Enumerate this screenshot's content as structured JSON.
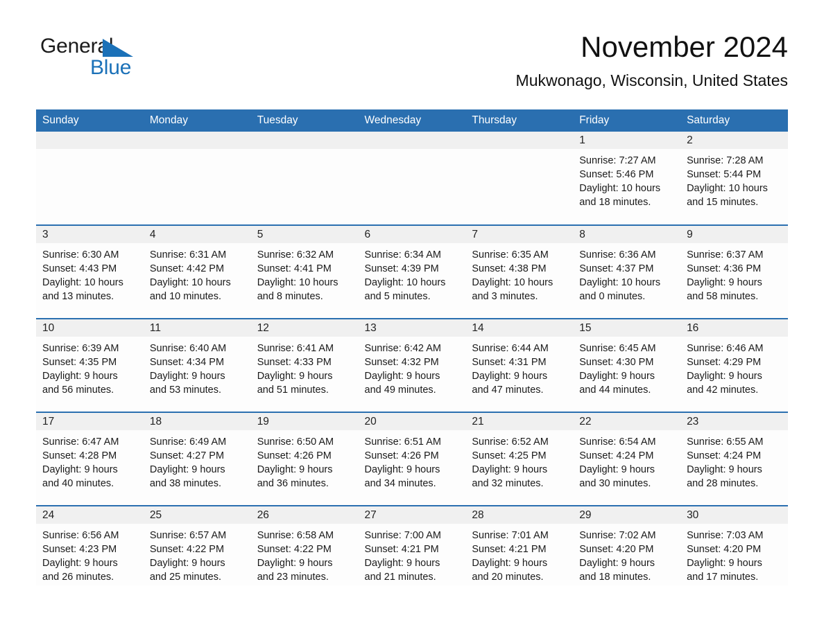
{
  "brand": {
    "name_part1": "General",
    "name_part2": "Blue",
    "logo_icon": "triangle-logo-icon"
  },
  "header": {
    "title": "November 2024",
    "subtitle": "Mukwonago, Wisconsin, United States"
  },
  "colors": {
    "header_blue": "#2a6fb0",
    "brand_blue": "#1b71b8",
    "day_band_gray": "#f0f0f0",
    "cell_background": "#fdfdfd",
    "text": "#1a1a1a"
  },
  "weekdays": [
    "Sunday",
    "Monday",
    "Tuesday",
    "Wednesday",
    "Thursday",
    "Friday",
    "Saturday"
  ],
  "weeks": [
    [
      {
        "day": "",
        "empty": true,
        "sunrise": "",
        "sunset": "",
        "daylight1": "",
        "daylight2": ""
      },
      {
        "day": "",
        "empty": true,
        "sunrise": "",
        "sunset": "",
        "daylight1": "",
        "daylight2": ""
      },
      {
        "day": "",
        "empty": true,
        "sunrise": "",
        "sunset": "",
        "daylight1": "",
        "daylight2": ""
      },
      {
        "day": "",
        "empty": true,
        "sunrise": "",
        "sunset": "",
        "daylight1": "",
        "daylight2": ""
      },
      {
        "day": "",
        "empty": true,
        "sunrise": "",
        "sunset": "",
        "daylight1": "",
        "daylight2": ""
      },
      {
        "day": "1",
        "empty": false,
        "sunrise": "Sunrise: 7:27 AM",
        "sunset": "Sunset: 5:46 PM",
        "daylight1": "Daylight: 10 hours",
        "daylight2": "and 18 minutes."
      },
      {
        "day": "2",
        "empty": false,
        "sunrise": "Sunrise: 7:28 AM",
        "sunset": "Sunset: 5:44 PM",
        "daylight1": "Daylight: 10 hours",
        "daylight2": "and 15 minutes."
      }
    ],
    [
      {
        "day": "3",
        "empty": false,
        "sunrise": "Sunrise: 6:30 AM",
        "sunset": "Sunset: 4:43 PM",
        "daylight1": "Daylight: 10 hours",
        "daylight2": "and 13 minutes."
      },
      {
        "day": "4",
        "empty": false,
        "sunrise": "Sunrise: 6:31 AM",
        "sunset": "Sunset: 4:42 PM",
        "daylight1": "Daylight: 10 hours",
        "daylight2": "and 10 minutes."
      },
      {
        "day": "5",
        "empty": false,
        "sunrise": "Sunrise: 6:32 AM",
        "sunset": "Sunset: 4:41 PM",
        "daylight1": "Daylight: 10 hours",
        "daylight2": "and 8 minutes."
      },
      {
        "day": "6",
        "empty": false,
        "sunrise": "Sunrise: 6:34 AM",
        "sunset": "Sunset: 4:39 PM",
        "daylight1": "Daylight: 10 hours",
        "daylight2": "and 5 minutes."
      },
      {
        "day": "7",
        "empty": false,
        "sunrise": "Sunrise: 6:35 AM",
        "sunset": "Sunset: 4:38 PM",
        "daylight1": "Daylight: 10 hours",
        "daylight2": "and 3 minutes."
      },
      {
        "day": "8",
        "empty": false,
        "sunrise": "Sunrise: 6:36 AM",
        "sunset": "Sunset: 4:37 PM",
        "daylight1": "Daylight: 10 hours",
        "daylight2": "and 0 minutes."
      },
      {
        "day": "9",
        "empty": false,
        "sunrise": "Sunrise: 6:37 AM",
        "sunset": "Sunset: 4:36 PM",
        "daylight1": "Daylight: 9 hours",
        "daylight2": "and 58 minutes."
      }
    ],
    [
      {
        "day": "10",
        "empty": false,
        "sunrise": "Sunrise: 6:39 AM",
        "sunset": "Sunset: 4:35 PM",
        "daylight1": "Daylight: 9 hours",
        "daylight2": "and 56 minutes."
      },
      {
        "day": "11",
        "empty": false,
        "sunrise": "Sunrise: 6:40 AM",
        "sunset": "Sunset: 4:34 PM",
        "daylight1": "Daylight: 9 hours",
        "daylight2": "and 53 minutes."
      },
      {
        "day": "12",
        "empty": false,
        "sunrise": "Sunrise: 6:41 AM",
        "sunset": "Sunset: 4:33 PM",
        "daylight1": "Daylight: 9 hours",
        "daylight2": "and 51 minutes."
      },
      {
        "day": "13",
        "empty": false,
        "sunrise": "Sunrise: 6:42 AM",
        "sunset": "Sunset: 4:32 PM",
        "daylight1": "Daylight: 9 hours",
        "daylight2": "and 49 minutes."
      },
      {
        "day": "14",
        "empty": false,
        "sunrise": "Sunrise: 6:44 AM",
        "sunset": "Sunset: 4:31 PM",
        "daylight1": "Daylight: 9 hours",
        "daylight2": "and 47 minutes."
      },
      {
        "day": "15",
        "empty": false,
        "sunrise": "Sunrise: 6:45 AM",
        "sunset": "Sunset: 4:30 PM",
        "daylight1": "Daylight: 9 hours",
        "daylight2": "and 44 minutes."
      },
      {
        "day": "16",
        "empty": false,
        "sunrise": "Sunrise: 6:46 AM",
        "sunset": "Sunset: 4:29 PM",
        "daylight1": "Daylight: 9 hours",
        "daylight2": "and 42 minutes."
      }
    ],
    [
      {
        "day": "17",
        "empty": false,
        "sunrise": "Sunrise: 6:47 AM",
        "sunset": "Sunset: 4:28 PM",
        "daylight1": "Daylight: 9 hours",
        "daylight2": "and 40 minutes."
      },
      {
        "day": "18",
        "empty": false,
        "sunrise": "Sunrise: 6:49 AM",
        "sunset": "Sunset: 4:27 PM",
        "daylight1": "Daylight: 9 hours",
        "daylight2": "and 38 minutes."
      },
      {
        "day": "19",
        "empty": false,
        "sunrise": "Sunrise: 6:50 AM",
        "sunset": "Sunset: 4:26 PM",
        "daylight1": "Daylight: 9 hours",
        "daylight2": "and 36 minutes."
      },
      {
        "day": "20",
        "empty": false,
        "sunrise": "Sunrise: 6:51 AM",
        "sunset": "Sunset: 4:26 PM",
        "daylight1": "Daylight: 9 hours",
        "daylight2": "and 34 minutes."
      },
      {
        "day": "21",
        "empty": false,
        "sunrise": "Sunrise: 6:52 AM",
        "sunset": "Sunset: 4:25 PM",
        "daylight1": "Daylight: 9 hours",
        "daylight2": "and 32 minutes."
      },
      {
        "day": "22",
        "empty": false,
        "sunrise": "Sunrise: 6:54 AM",
        "sunset": "Sunset: 4:24 PM",
        "daylight1": "Daylight: 9 hours",
        "daylight2": "and 30 minutes."
      },
      {
        "day": "23",
        "empty": false,
        "sunrise": "Sunrise: 6:55 AM",
        "sunset": "Sunset: 4:24 PM",
        "daylight1": "Daylight: 9 hours",
        "daylight2": "and 28 minutes."
      }
    ],
    [
      {
        "day": "24",
        "empty": false,
        "sunrise": "Sunrise: 6:56 AM",
        "sunset": "Sunset: 4:23 PM",
        "daylight1": "Daylight: 9 hours",
        "daylight2": "and 26 minutes."
      },
      {
        "day": "25",
        "empty": false,
        "sunrise": "Sunrise: 6:57 AM",
        "sunset": "Sunset: 4:22 PM",
        "daylight1": "Daylight: 9 hours",
        "daylight2": "and 25 minutes."
      },
      {
        "day": "26",
        "empty": false,
        "sunrise": "Sunrise: 6:58 AM",
        "sunset": "Sunset: 4:22 PM",
        "daylight1": "Daylight: 9 hours",
        "daylight2": "and 23 minutes."
      },
      {
        "day": "27",
        "empty": false,
        "sunrise": "Sunrise: 7:00 AM",
        "sunset": "Sunset: 4:21 PM",
        "daylight1": "Daylight: 9 hours",
        "daylight2": "and 21 minutes."
      },
      {
        "day": "28",
        "empty": false,
        "sunrise": "Sunrise: 7:01 AM",
        "sunset": "Sunset: 4:21 PM",
        "daylight1": "Daylight: 9 hours",
        "daylight2": "and 20 minutes."
      },
      {
        "day": "29",
        "empty": false,
        "sunrise": "Sunrise: 7:02 AM",
        "sunset": "Sunset: 4:20 PM",
        "daylight1": "Daylight: 9 hours",
        "daylight2": "and 18 minutes."
      },
      {
        "day": "30",
        "empty": false,
        "sunrise": "Sunrise: 7:03 AM",
        "sunset": "Sunset: 4:20 PM",
        "daylight1": "Daylight: 9 hours",
        "daylight2": "and 17 minutes."
      }
    ]
  ]
}
